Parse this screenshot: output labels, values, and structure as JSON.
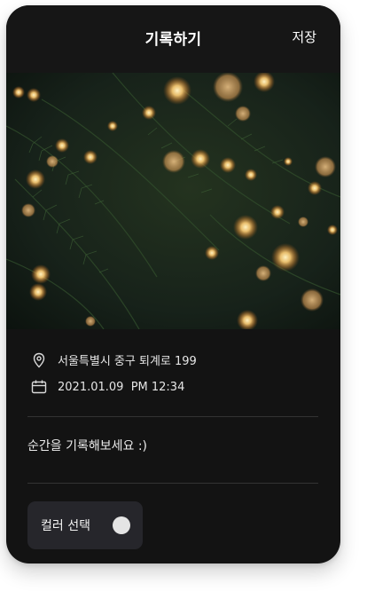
{
  "header": {
    "title": "기록하기",
    "save_label": "저장"
  },
  "details": {
    "location": "서울특별시 중구 퇴계로 199",
    "datetime": "2021.01.09  PM 12:34"
  },
  "memo": {
    "placeholder": "순간을 기록해보세요 :)"
  },
  "color_picker": {
    "label": "컬러 선택",
    "selected_color": "#e4e4e4"
  },
  "icons": {
    "location": "location-pin-icon",
    "calendar": "calendar-icon"
  },
  "colors": {
    "background": "#131313",
    "card": "#26262b",
    "text": "#ffffff",
    "divider": "#333333"
  }
}
